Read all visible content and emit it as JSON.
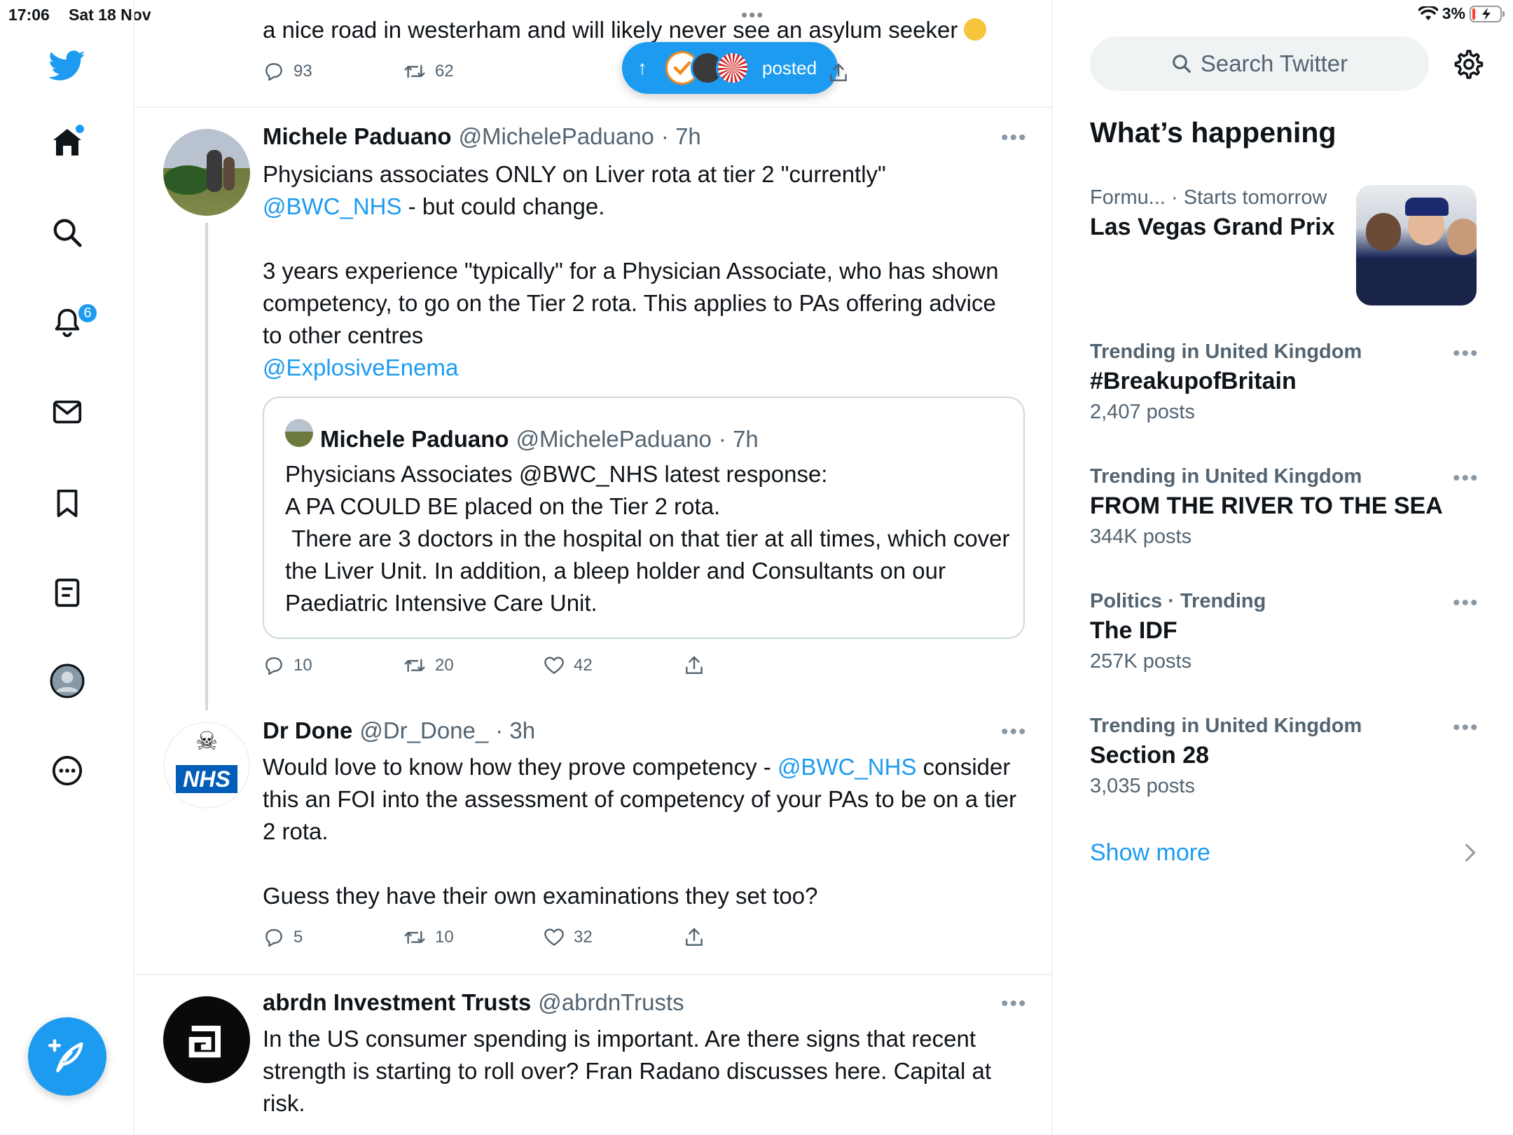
{
  "status_bar": {
    "time": "17:06",
    "date": "Sat 18 Nov",
    "battery": "3%"
  },
  "nav": {
    "notifications_badge": "6"
  },
  "pill": {
    "label": "posted"
  },
  "top_tweet": {
    "text": "a nice road in westerham and will likely never see an asylum seeker",
    "replies": "93",
    "retweets": "62"
  },
  "tweet1": {
    "name": "Michele Paduano",
    "handle": "@MichelePaduano",
    "time": "· 7h",
    "text_line1": "Physicians associates ONLY on Liver rota at tier 2 \"currently\"",
    "mention1": "@BWC_NHS",
    "text_line2_rest": " - but could change.",
    "text_para2": "3 years experience \"typically\" for a Physician Associate, who has shown competency, to go on the Tier 2 rota. This applies to PAs offering advice to other centres",
    "mention2": "@ExplosiveEnema",
    "quote": {
      "name": "Michele Paduano",
      "handle": "@MichelePaduano",
      "time": "· 7h",
      "text_line1": "Physicians Associates @BWC_NHS latest response:",
      "text_line2": "A PA COULD BE placed on the Tier 2 rota.",
      "text_para": " There are 3 doctors in the hospital on that tier at all times, which cover the Liver Unit. In addition, a bleep holder and Consultants on our Paediatric Intensive Care Unit."
    },
    "replies": "10",
    "retweets": "20",
    "likes": "42"
  },
  "tweet2": {
    "name": "Dr Done",
    "handle": "@Dr_Done_",
    "time": "· 3h",
    "text_start": "Would love to know how they prove competency - ",
    "mention": "@BWC_NHS",
    "text_end": " consider this an FOI into the assessment of competency of your PAs to be on a tier 2 rota.",
    "text_para2": "Guess they have their own examinations they set too?",
    "avatar_label": "NHS",
    "replies": "5",
    "retweets": "10",
    "likes": "32"
  },
  "tweet3": {
    "name": "abrdn Investment Trusts",
    "handle": "@abrdnTrusts",
    "text": "In the US consumer spending is important. Are there signs that recent strength is starting to roll over? Fran Radano discusses here. Capital at risk."
  },
  "sidebar": {
    "search_placeholder": "Search Twitter",
    "section_title": "What’s happening",
    "featured": {
      "category": "Formu...",
      "meta": "· Starts tomorrow",
      "title": "Las Vegas Grand Prix"
    },
    "trends": [
      {
        "meta": "Trending in United Kingdom",
        "title": "#BreakupofBritain",
        "count": "2,407 posts"
      },
      {
        "meta": "Trending in United Kingdom",
        "title": "FROM THE RIVER TO THE SEA",
        "count": "344K posts"
      },
      {
        "meta": "Politics · Trending",
        "title": "The IDF",
        "count": "257K posts"
      },
      {
        "meta": "Trending in United Kingdom",
        "title": "Section 28",
        "count": "3,035 posts"
      }
    ],
    "show_more": "Show more"
  },
  "colors": {
    "accent": "#1d9bf0",
    "text_primary": "#0f1419",
    "text_secondary": "#536471",
    "border": "#eff3f4"
  }
}
